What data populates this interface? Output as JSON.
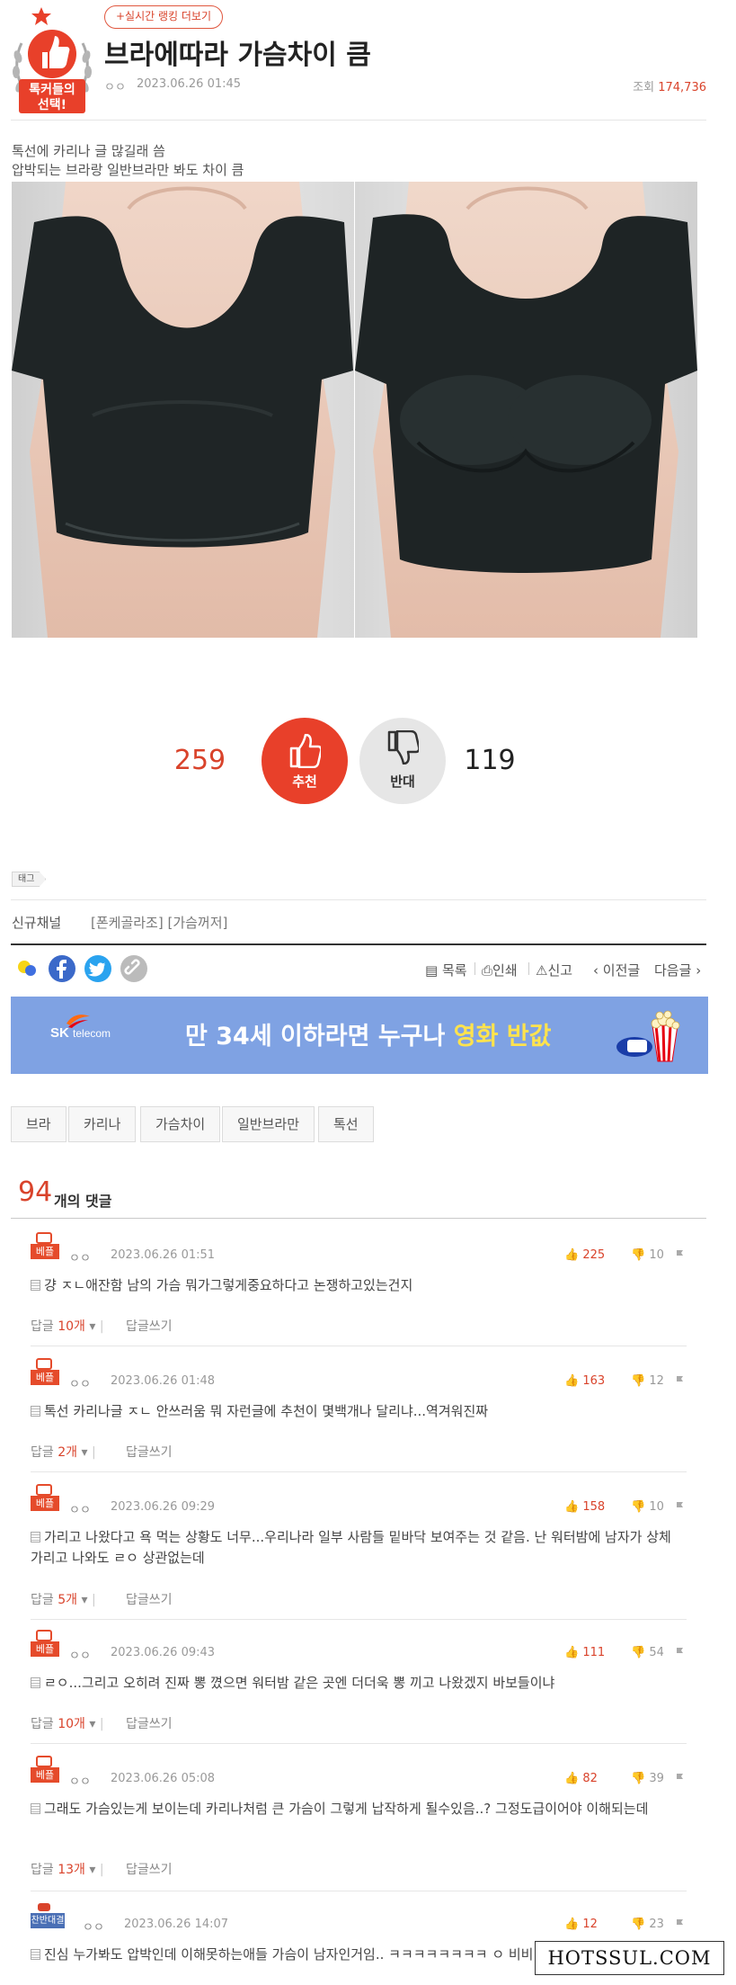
{
  "header": {
    "badge_text_line1": "톡커들의",
    "badge_text_line2": "선택!",
    "live_rank_link": "+실시간 랭킹 더보기",
    "title": "브라에따라 가슴차이 큼",
    "author": "ㅇㅇ",
    "date": "2023.06.26 01:45",
    "views_label": "조회",
    "views": "174,736"
  },
  "body": {
    "lines": [
      "톡선에 카리나 글 많길래 씀",
      "압박되는 브라랑 일반브라만 봐도 차이 큼"
    ]
  },
  "votes": {
    "up_count": "259",
    "up_label": "추천",
    "down_label": "반대",
    "down_count": "119"
  },
  "tags": {
    "label": "태그",
    "channel_label": "신규채널",
    "channel_value": "[폰케골라조] [가슴꺼저]"
  },
  "nav": {
    "list": "목록",
    "print": "인쇄",
    "report": "신고",
    "prev": "이전글",
    "next": "다음글"
  },
  "ad": {
    "brand": "SK",
    "brand_sub": "telecom",
    "text_main": "만 34세 이하라면 누구나 ",
    "text_highlight": "영화 반값",
    "highlight_color": "#ffe34d"
  },
  "keywords": [
    "브라",
    "카리나",
    "가슴차이",
    "일반브라만",
    "톡선"
  ],
  "comments_header": {
    "count": "94",
    "suffix": "개의 댓글"
  },
  "comments": [
    {
      "badge": "베플",
      "author": "ㅇㅇ",
      "date": "2023.06.26 01:51",
      "likes": "225",
      "dislikes": "10",
      "text": "걍 ㅈㄴ애잔함 남의 가슴 뭐가그렇게중요하다고 논쟁하고있는건지",
      "reply_label": "답글",
      "reply_count": "10개",
      "write_reply": "답글쓰기"
    },
    {
      "badge": "베플",
      "author": "ㅇㅇ",
      "date": "2023.06.26 01:48",
      "likes": "163",
      "dislikes": "12",
      "text": "톡선 카리나글 ㅈㄴ 안쓰러움 뭐 자런글에 추천이 몇백개나 달리냐...역겨워진짜",
      "reply_label": "답글",
      "reply_count": "2개",
      "write_reply": "답글쓰기"
    },
    {
      "badge": "베플",
      "author": "ㅇㅇ",
      "date": "2023.06.26 09:29",
      "likes": "158",
      "dislikes": "10",
      "text": "가리고 나왔다고 욕 먹는 상황도 너무...우리나라 일부 사람들 밑바닥 보여주는 것 같음. 난 워터밤에 남자가 상체 가리고 나와도 ㄹㅇ 상관없는데",
      "reply_label": "답글",
      "reply_count": "5개",
      "write_reply": "답글쓰기"
    },
    {
      "badge": "베플",
      "author": "ㅇㅇ",
      "date": "2023.06.26 09:43",
      "likes": "111",
      "dislikes": "54",
      "text": "ㄹㅇ...그리고 오히려 진짜 뽕 꼈으면 워터밤 같은 곳엔 더더욱 뽕 끼고 나왔겠지 바보들이냐",
      "reply_label": "답글",
      "reply_count": "10개",
      "write_reply": "답글쓰기"
    },
    {
      "badge": "베플",
      "author": "ㅇㅇ",
      "date": "2023.06.26 05:08",
      "likes": "82",
      "dislikes": "39",
      "text": "그래도 가슴있는게 보이는데 카리나처럼 큰 가슴이 그렇게 납작하게 될수있음..? 그정도급이어야 이해되는데",
      "reply_label": "답글",
      "reply_count": "13개",
      "write_reply": "답글쓰기"
    },
    {
      "badge": "찬반대결",
      "author": "ㅇㅇ",
      "date": "2023.06.26 14:07",
      "likes": "12",
      "dislikes": "23",
      "text": "진심 누가봐도 압박인데 이해못하는애들 가슴이 남자인거임.. ㅋㅋㅋㅋㅋㅋㅋㅋ ㅇ 비비안꺼 좋으니까 써봐!!"
    }
  ],
  "watermark": "HOTSSUL.COM",
  "colors": {
    "accent": "#d9432b",
    "vote_up": "#e8402a",
    "vote_down": "#e6e6e6",
    "ad_bg": "#7fa2e3"
  }
}
